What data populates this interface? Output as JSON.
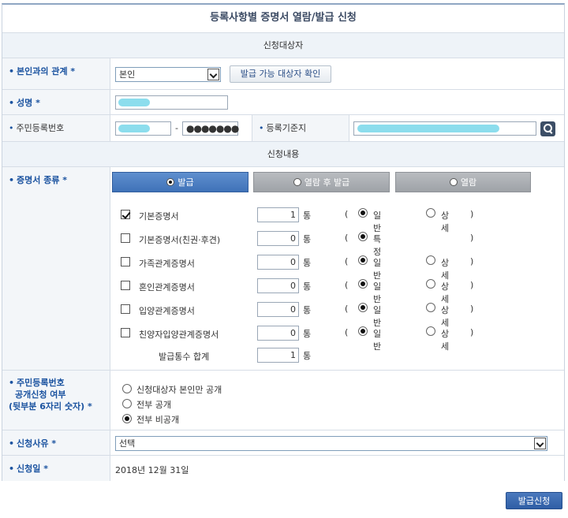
{
  "title": "등록사항별 증명서 열람/발급 신청",
  "sections": {
    "target": "신청대상자",
    "content": "신청내용"
  },
  "relation": {
    "label": "본인과의 관계 *",
    "value": "본인",
    "check_button": "발급 가능 대상자 확인"
  },
  "name": {
    "label": "성명 *"
  },
  "resident": {
    "label": "주민등록번호",
    "dash": "-",
    "back_masked": "●●●●●●●",
    "registry_label": "등록기준지"
  },
  "tabs": [
    {
      "label": "발급",
      "selected": true
    },
    {
      "label": "열람 후 발급",
      "selected": false
    },
    {
      "label": "열람",
      "selected": false
    }
  ],
  "certs": {
    "label": "증명서 종류 *",
    "unit": "통",
    "open": "(",
    "close": ")",
    "items": [
      {
        "name": "기본증명서",
        "checked": true,
        "qty": "1",
        "opt1": "일반",
        "opt2": "상세"
      },
      {
        "name": "기본증명서(친권·후견)",
        "checked": false,
        "qty": "0",
        "opt1": "특정",
        "opt2": ""
      },
      {
        "name": "가족관계증명서",
        "checked": false,
        "qty": "0",
        "opt1": "일반",
        "opt2": "상세"
      },
      {
        "name": "혼인관계증명서",
        "checked": false,
        "qty": "0",
        "opt1": "일반",
        "opt2": "상세"
      },
      {
        "name": "입양관계증명서",
        "checked": false,
        "qty": "0",
        "opt1": "일반",
        "opt2": "상세"
      },
      {
        "name": "친양자입양관계증명서",
        "checked": false,
        "qty": "0",
        "opt1": "일반",
        "opt2": "상세"
      }
    ],
    "total_label": "발급통수 합계",
    "total_value": "1"
  },
  "disclosure": {
    "label_line1": "주민등록번호",
    "label_line2": "공개신청 여부",
    "label_line3": "(뒷부분 6자리 숫자) *",
    "options": [
      {
        "label": "신청대상자 본인만 공개",
        "selected": false
      },
      {
        "label": "전부 공개",
        "selected": false
      },
      {
        "label": "전부 비공개",
        "selected": true
      }
    ]
  },
  "reason": {
    "label": "신청사유 *",
    "value": "선택"
  },
  "date": {
    "label": "신청일 *",
    "value": "2018년 12월 31일"
  },
  "submit_label": "발급신청",
  "colors": {
    "accent": "#1b53a0",
    "tab_active": "#3f72b8",
    "tab_inactive": "#9ea2a7",
    "masked_highlight": "#6fd5e8"
  }
}
